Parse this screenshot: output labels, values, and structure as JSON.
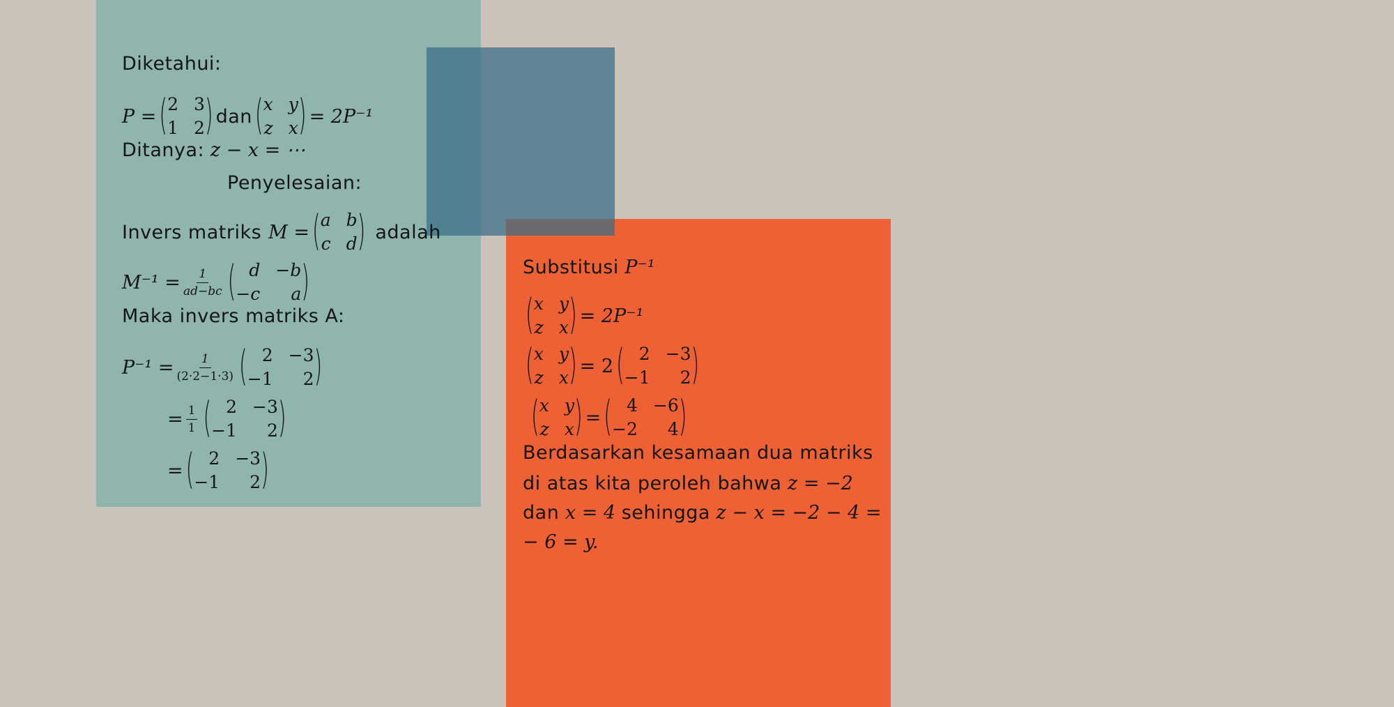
{
  "left": {
    "diketahui": "Diketahui:",
    "line_p_lhs": "P =",
    "p_matrix": [
      "2",
      "3",
      "1",
      "2"
    ],
    "dan": "dan",
    "xyzx_matrix": [
      "x",
      "y",
      "z",
      "x"
    ],
    "eq_2pinv": "= 2P⁻¹",
    "ditanya_label": "Ditanya:",
    "ditanya_expr": "z − x = ⋯",
    "penyelesaian": "Penyelesaian:",
    "invers_label": "Invers matriks",
    "m_eq": "M =",
    "m_matrix": [
      "a",
      "b",
      "c",
      "d"
    ],
    "adalah": "adalah",
    "minv_lhs": "M⁻¹ =",
    "minv_frac_num": "1",
    "minv_frac_den": "ad−bc",
    "minv_matrix": [
      "d",
      "−b",
      "−c",
      "a"
    ],
    "maka": "Maka invers matriks A:",
    "pinv_lhs": "P⁻¹ =",
    "pinv_frac_num": "1",
    "pinv_frac_den": "(2·2−1·3)",
    "pinv_matrix": [
      "2",
      "−3",
      "−1",
      "2"
    ],
    "step2_eq": "=",
    "step2_frac_num": "1",
    "step2_frac_den": "1",
    "step2_matrix": [
      "2",
      "−3",
      "−1",
      "2"
    ],
    "step3_eq": "=",
    "step3_matrix": [
      "2",
      "−3",
      "−1",
      "2"
    ]
  },
  "right": {
    "substitusi_label": "Substitusi",
    "substitusi_expr": "P⁻¹",
    "r1_matrix": [
      "x",
      "y",
      "z",
      "x"
    ],
    "r1_rhs": "= 2P⁻¹",
    "r2_matrix": [
      "x",
      "y",
      "z",
      "x"
    ],
    "r2_eq": "= 2",
    "r2_rhs_matrix": [
      "2",
      "−3",
      "−1",
      "2"
    ],
    "r3_matrix": [
      "x",
      "y",
      "z",
      "x"
    ],
    "r3_eq": "=",
    "r3_rhs_matrix": [
      "4",
      "−6",
      "−2",
      "4"
    ],
    "p1": "Berdasarkan kesamaan dua matriks",
    "p2_text": "di atas kita peroleh bahwa",
    "p2_expr": "z = −2",
    "p3_text1": "dan",
    "p3_expr1": "x = 4",
    "p3_text2": "sehingga",
    "p3_expr2": "z − x = −2 − 4 =",
    "p4_expr": "− 6 = y."
  },
  "colors": {
    "background": "#cbc3b9",
    "teal_panel": "#8fb5ad",
    "orange_panel": "#ee6134",
    "blue_overlay": "#3f7a92"
  }
}
